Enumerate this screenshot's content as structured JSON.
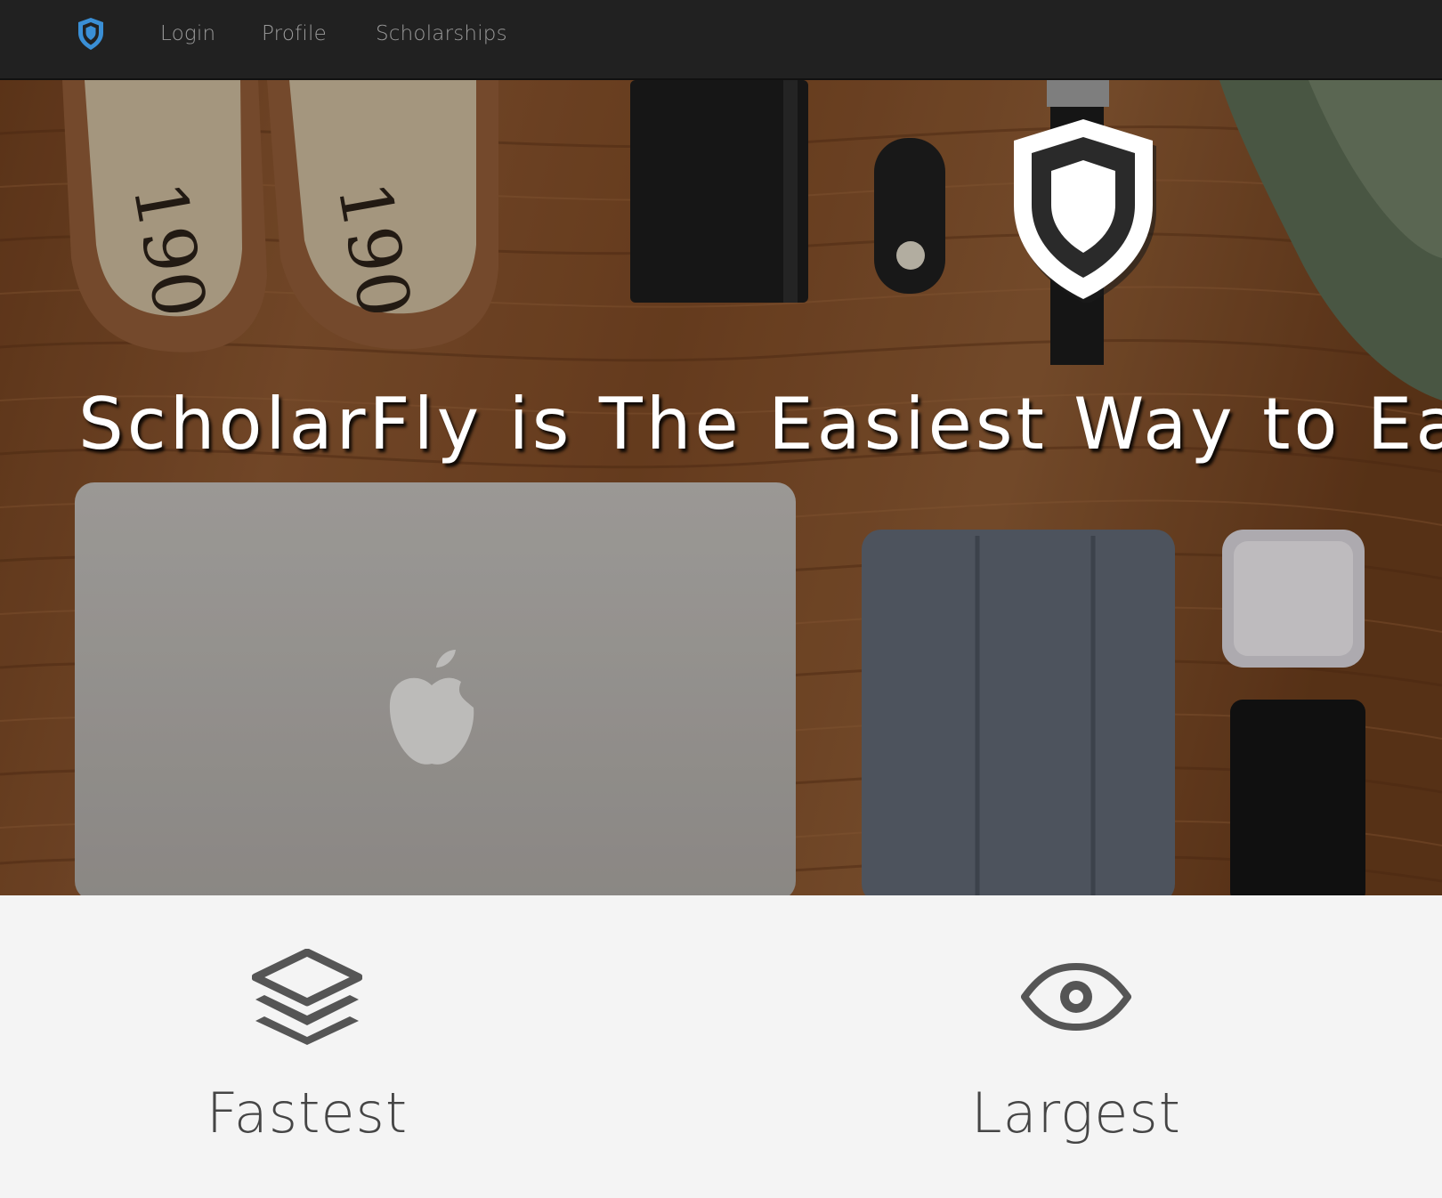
{
  "nav": {
    "logo_icon": "shield-icon",
    "links": [
      {
        "label": "Login"
      },
      {
        "label": "Profile"
      },
      {
        "label": "Scholarships"
      }
    ]
  },
  "hero": {
    "title": "ScholarFly is The Easiest Way to Earn",
    "shield_icon": "shield-icon",
    "background": "photo of flat-lay items on wood (shoes, wallet, key fob, watch, bag, laptop, tablet, earbuds, phone)"
  },
  "features": [
    {
      "icon": "layers-icon",
      "title": "Fastest"
    },
    {
      "icon": "eye-icon",
      "title": "Largest"
    }
  ],
  "colors": {
    "navbar": "#212121",
    "nav_text": "#9a9a9a",
    "logo_blue": "#3a8fd6",
    "feature_bg": "#f4f4f4",
    "feature_text": "#454545",
    "icon_gray": "#555555"
  }
}
